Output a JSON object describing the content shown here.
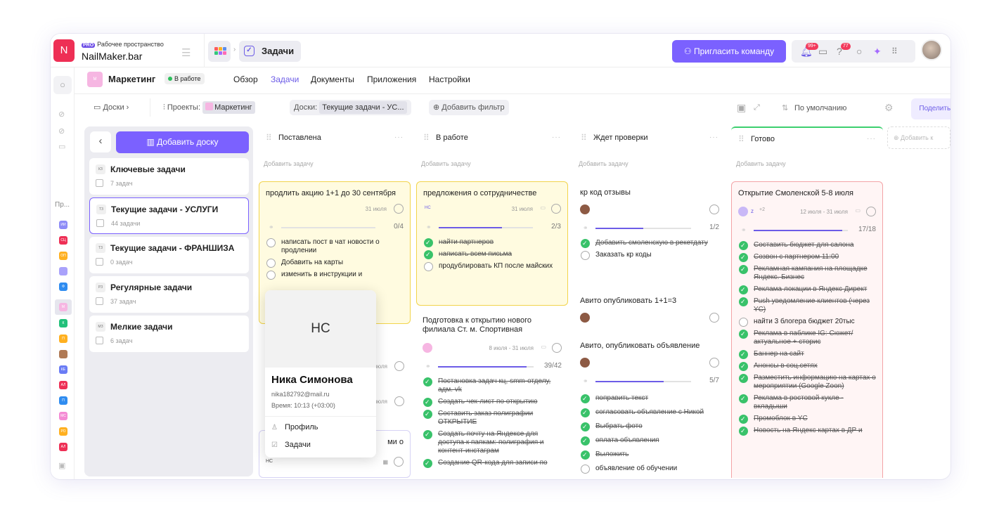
{
  "workspace": {
    "logo_letter": "N",
    "pro_badge": "PRO",
    "label": "Рабочее пространство",
    "name": "NailMaker.bar"
  },
  "header": {
    "breadcrumb_page": "Задачи",
    "invite_label": "Пригласить команду",
    "notif_badge": "99+",
    "help_badge": "77"
  },
  "rail": {
    "projects_label": "Пр...",
    "project_abbrs": [
      "ИИ",
      "СЦ",
      "ОП",
      "",
      "Ф",
      "М",
      "К",
      "П",
      "",
      "КЕ",
      "АЛ",
      "П",
      "МС",
      "РО",
      "АЛ"
    ]
  },
  "project": {
    "logo_abbr": "М",
    "name": "Маркетинг",
    "status": "В работе",
    "tabs": [
      "Обзор",
      "Задачи",
      "Документы",
      "Приложения",
      "Настройки"
    ],
    "active_tab": "Задачи"
  },
  "filters": {
    "boards_label": "Доски",
    "projects_label": "Проекты:",
    "projects_value": "Маркетинг",
    "boards_filter_label": "Доски:",
    "boards_filter_value": "Текущие задачи - УС...",
    "add_filter": "Добавить фильтр",
    "sort": "По умолчанию",
    "share": "Поделиться"
  },
  "boards": {
    "add_label": "Добавить доску",
    "items": [
      {
        "abbr": "КЗ",
        "title": "Ключевые задачи",
        "count": "7 задач"
      },
      {
        "abbr": "ТЗ",
        "title": "Текущие задачи - УСЛУГИ",
        "count": "44 задачи"
      },
      {
        "abbr": "ТЗ",
        "title": "Текущие задачи - ФРАНШИЗА",
        "count": "0 задач"
      },
      {
        "abbr": "РЗ",
        "title": "Регулярные задачи",
        "count": "37 задач"
      },
      {
        "abbr": "МЗ",
        "title": "Мелкие задачи",
        "count": "6 задач"
      }
    ]
  },
  "columns": [
    {
      "title": "Поставлена",
      "add": "Добавить задачу"
    },
    {
      "title": "В работе",
      "add": "Добавить задачу"
    },
    {
      "title": "Ждет проверки",
      "add": "Добавить задачу"
    },
    {
      "title": "Готово",
      "add": "Добавить задачу"
    }
  ],
  "add_column": "Добавить к",
  "col1": {
    "card1": {
      "title": "продлить акцию 1+1 до 30 сентября",
      "date": "31 июля",
      "progress": "0/4",
      "fraction": 0,
      "items": [
        {
          "text": "написать пост в чат новости о продлении",
          "done": false
        },
        {
          "text": "Добавить на карты",
          "done": false
        },
        {
          "text": "изменить в инструкции и",
          "done": false
        }
      ]
    },
    "card2": {
      "date": "8 июля",
      "tail": "ми о"
    },
    "card3": {
      "date": "8 июля",
      "abbr": "НС"
    }
  },
  "col2": {
    "card1": {
      "title": "предложения о сотрудничестве",
      "abbr": "НС",
      "date": "31 июля",
      "progress": "2/3",
      "fraction": 0.67,
      "items": [
        {
          "text": "найти партнеров",
          "done": true
        },
        {
          "text": "написать всем письма",
          "done": true
        },
        {
          "text": "продублировать КП после майских",
          "done": false
        }
      ]
    },
    "card2": {
      "title": "Подготовка к открытию нового филиала Ст. м. Спортивная",
      "date": "8 июля - 31 июля",
      "progress": "39/42",
      "fraction": 0.93,
      "items": [
        {
          "text": "Постановка задач кц, smm-отделу, адм. vk",
          "done": true
        },
        {
          "text": "Создать чек-лист по открытию",
          "done": true
        },
        {
          "text": "Составить заказ полиграфии ОТКРЫТИЕ",
          "done": true
        },
        {
          "text": "Создать почту на Яндексе для доступа к папкам: полиграфия и контент-инстаграм",
          "done": true
        },
        {
          "text": "Создание QR-кода для записи по",
          "done": true
        }
      ]
    }
  },
  "col3": {
    "card1": {
      "title": "кр код отзывы",
      "progress": "1/2",
      "fraction": 0.5,
      "items": [
        {
          "text": "Добавить смоленскую в рекетдату",
          "done": true
        },
        {
          "text": "Заказать кр коды",
          "done": false
        }
      ]
    },
    "card2": {
      "title": "Авито опубликовать 1+1=3"
    },
    "card3": {
      "title": "Авито, опубликовать объявление",
      "progress": "5/7",
      "fraction": 0.71,
      "items": [
        {
          "text": "поправить текст",
          "done": true
        },
        {
          "text": "согласовать объявление с Никой",
          "done": true
        },
        {
          "text": "Выбрать фото",
          "done": true
        },
        {
          "text": "оплата объявления",
          "done": true
        },
        {
          "text": "Выложить",
          "done": true
        },
        {
          "text": "объявление об обучении",
          "done": false
        }
      ]
    }
  },
  "col4": {
    "card1": {
      "title": "Открытие Смоленской 5-8 июля",
      "assignee": "z",
      "extra": "+2",
      "date": "12 июля - 31 июля",
      "progress": "17/18",
      "fraction": 0.94,
      "items": [
        {
          "text": "Составить бюджет для салона",
          "done": true
        },
        {
          "text": "Созвон с партнером 11:00",
          "done": true
        },
        {
          "text": "Рекламная кампания на площадке Яндекс. Бизнес",
          "done": true
        },
        {
          "text": "Реклама локации в Яндекс Директ",
          "done": true
        },
        {
          "text": "Push уведомление клиентов (через YC)",
          "done": true
        },
        {
          "text": "найти 3 блогера бюджет 20тыс",
          "done": false
        },
        {
          "text": "Реклама в пабликe IG: Сюжет/актуальное + сторис",
          "done": true
        },
        {
          "text": "Баннер на сайт",
          "done": true
        },
        {
          "text": "Анонсы в соц.сетях",
          "done": true
        },
        {
          "text": "Разместить информацию на картах о мероприятии (Google Zoon)",
          "done": true
        },
        {
          "text": "Реклама в ростовой кукле - вкладыши",
          "done": true
        },
        {
          "text": "Промоблок в YC",
          "done": true
        },
        {
          "text": "Новость на Яндекс картах в ДР и",
          "done": true
        }
      ]
    }
  },
  "popup": {
    "initials": "НС",
    "name": "Ника Симонова",
    "email": "nika182792@mail.ru",
    "time": "Время: 10:13 (+03:00)",
    "profile": "Профиль",
    "tasks": "Задачи"
  }
}
